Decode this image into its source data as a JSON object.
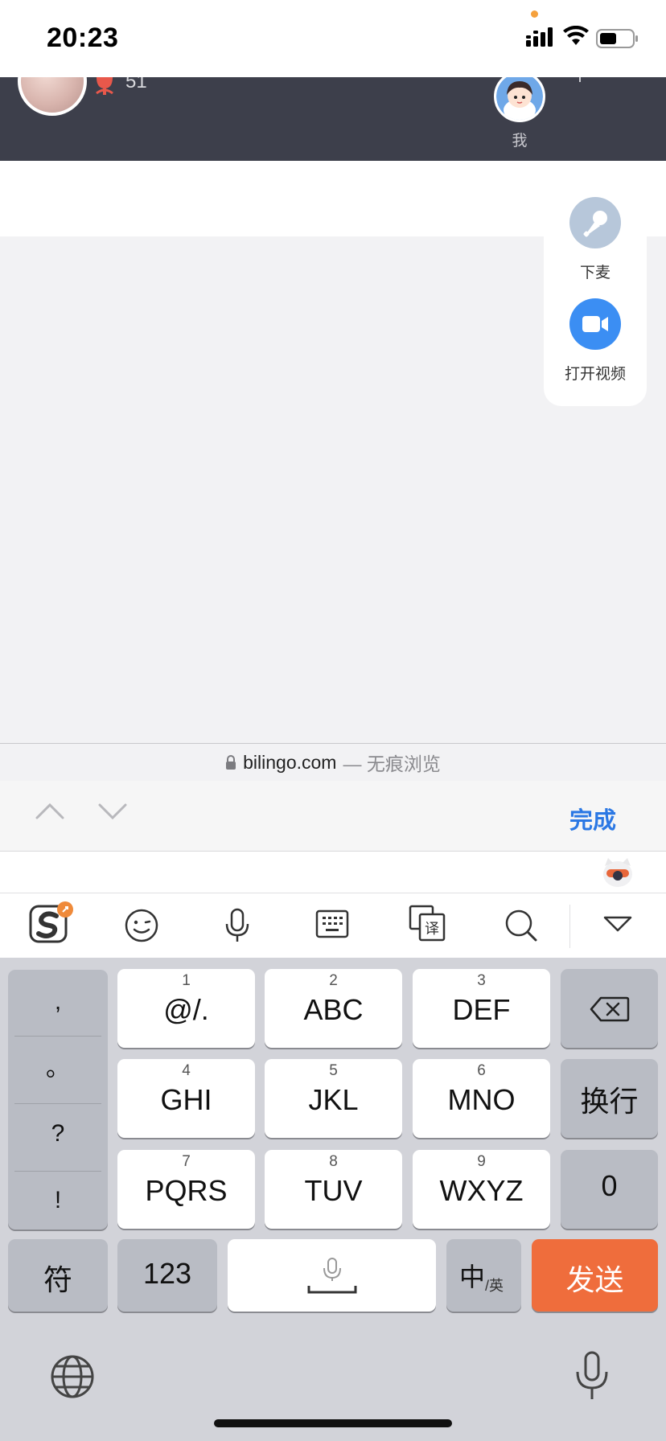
{
  "status_bar": {
    "time": "20:23"
  },
  "room_header": {
    "gift_count": "51",
    "me_label": "我"
  },
  "side_panel": {
    "mic_off_label": "下麦",
    "open_video_label": "打开视频"
  },
  "url_bar": {
    "domain": "bilingo.com",
    "suffix": "— 无痕浏览"
  },
  "accessory_bar": {
    "done_label": "完成"
  },
  "ime_toolbar": {
    "icons": [
      "sogou-logo-icon",
      "emoji-icon",
      "voice-input-icon",
      "keyboard-layout-icon",
      "translate-icon",
      "search-icon",
      "hide-keyboard-icon"
    ]
  },
  "keyboard": {
    "punctuation": [
      ",",
      "。",
      "?",
      "!"
    ],
    "keys": [
      {
        "num": "1",
        "letters": "@/."
      },
      {
        "num": "2",
        "letters": "ABC"
      },
      {
        "num": "3",
        "letters": "DEF"
      },
      {
        "num": "4",
        "letters": "GHI"
      },
      {
        "num": "5",
        "letters": "JKL"
      },
      {
        "num": "6",
        "letters": "MNO"
      },
      {
        "num": "7",
        "letters": "PQRS"
      },
      {
        "num": "8",
        "letters": "TUV"
      },
      {
        "num": "9",
        "letters": "WXYZ"
      }
    ],
    "newline_label": "换行",
    "zero_label": "0",
    "symbols_label": "符",
    "numeric_label": "123",
    "lang_main": "中",
    "lang_sub": "/英",
    "send_label": "发送"
  },
  "colors": {
    "accent_blue": "#3b8ef3",
    "send_orange": "#ef6d3c",
    "header_dark": "#3d3f4b"
  }
}
